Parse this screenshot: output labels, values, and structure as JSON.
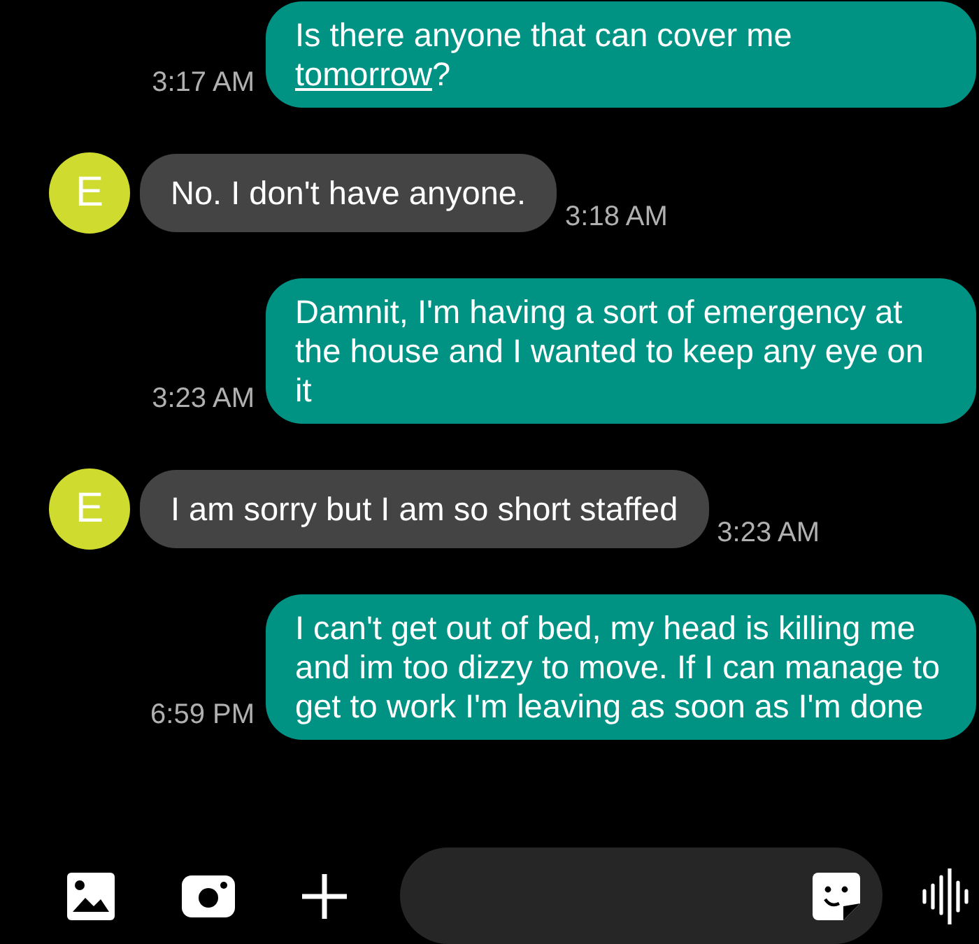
{
  "messages": [
    {
      "kind": "outgoing",
      "parts": [
        {
          "text": "Is there anyone that can cover me ",
          "link": false
        },
        {
          "text": "tomorrow",
          "link": true
        },
        {
          "text": "?",
          "link": false
        }
      ],
      "time": "3:17 AM"
    },
    {
      "kind": "incoming",
      "avatar": "E",
      "parts": [
        {
          "text": "No. I don't have anyone.",
          "link": false
        }
      ],
      "time": "3:18 AM"
    },
    {
      "kind": "outgoing",
      "parts": [
        {
          "text": "Damnit, I'm having a sort of emergency at the house and I wanted to keep any eye on it",
          "link": false
        }
      ],
      "time": "3:23 AM"
    },
    {
      "kind": "incoming",
      "avatar": "E",
      "parts": [
        {
          "text": "I am sorry but I am so short staffed",
          "link": false
        }
      ],
      "time": "3:23 AM"
    },
    {
      "kind": "outgoing",
      "parts": [
        {
          "text": "I can't get out of bed, my head is killing me and im too dizzy to move. If I can manage to get to work I'm leaving as soon as I'm done",
          "link": false
        }
      ],
      "time": "6:59 PM"
    }
  ]
}
